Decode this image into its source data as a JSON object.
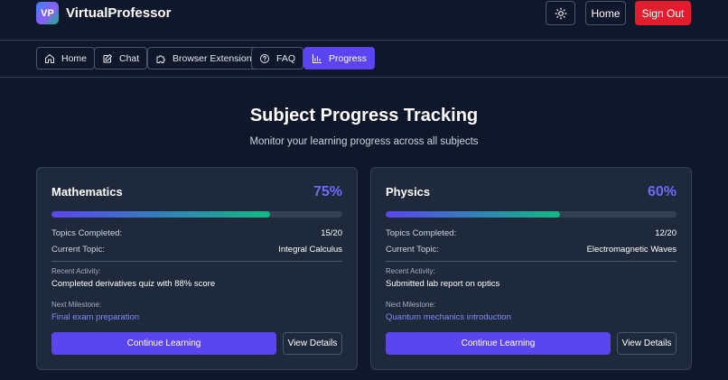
{
  "header": {
    "logo_text": "VP",
    "brand": "VirtualProfessor",
    "theme_icon": "sun-icon",
    "home_label": "Home",
    "signout_label": "Sign Out",
    "signout_color": "#e11d2e"
  },
  "nav": {
    "tabs": [
      {
        "label": "Home",
        "icon": "home-icon"
      },
      {
        "label": "Chat",
        "icon": "edit-icon"
      },
      {
        "label": "Browser Extension",
        "icon": "puzzle-icon"
      },
      {
        "label": "FAQ",
        "icon": "help-circle-icon"
      },
      {
        "label": "Progress",
        "icon": "bar-chart-icon",
        "active": true
      }
    ]
  },
  "page": {
    "title": "Subject Progress Tracking",
    "subtitle": "Monitor your learning progress across all subjects"
  },
  "subjects": [
    {
      "name": "Mathematics",
      "percent": "75%",
      "progress": 0.75,
      "topics_label": "Topics Completed:",
      "topics_value": "15/20",
      "current_label": "Current Topic:",
      "current_value": "Integral Calculus",
      "activity_label": "Recent Activity:",
      "activity_value": "Completed derivatives quiz with 88% score",
      "milestone_label": "Next Milestone:",
      "milestone_value": "Final exam preparation",
      "continue_label": "Continue Learning",
      "details_label": "View Details"
    },
    {
      "name": "Physics",
      "percent": "60%",
      "progress": 0.6,
      "topics_label": "Topics Completed:",
      "topics_value": "12/20",
      "current_label": "Current Topic:",
      "current_value": "Electromagnetic Waves",
      "activity_label": "Recent Activity:",
      "activity_value": "Submitted lab report on optics",
      "milestone_label": "Next Milestone:",
      "milestone_value": "Quantum mechanics introduction",
      "continue_label": "Continue Learning",
      "details_label": "View Details"
    }
  ],
  "colors": {
    "background": "#0f172a",
    "card": "#1e293b",
    "accent": "#5b45f0",
    "percent": "#6c6cf5",
    "progress_end": "#10b981"
  }
}
